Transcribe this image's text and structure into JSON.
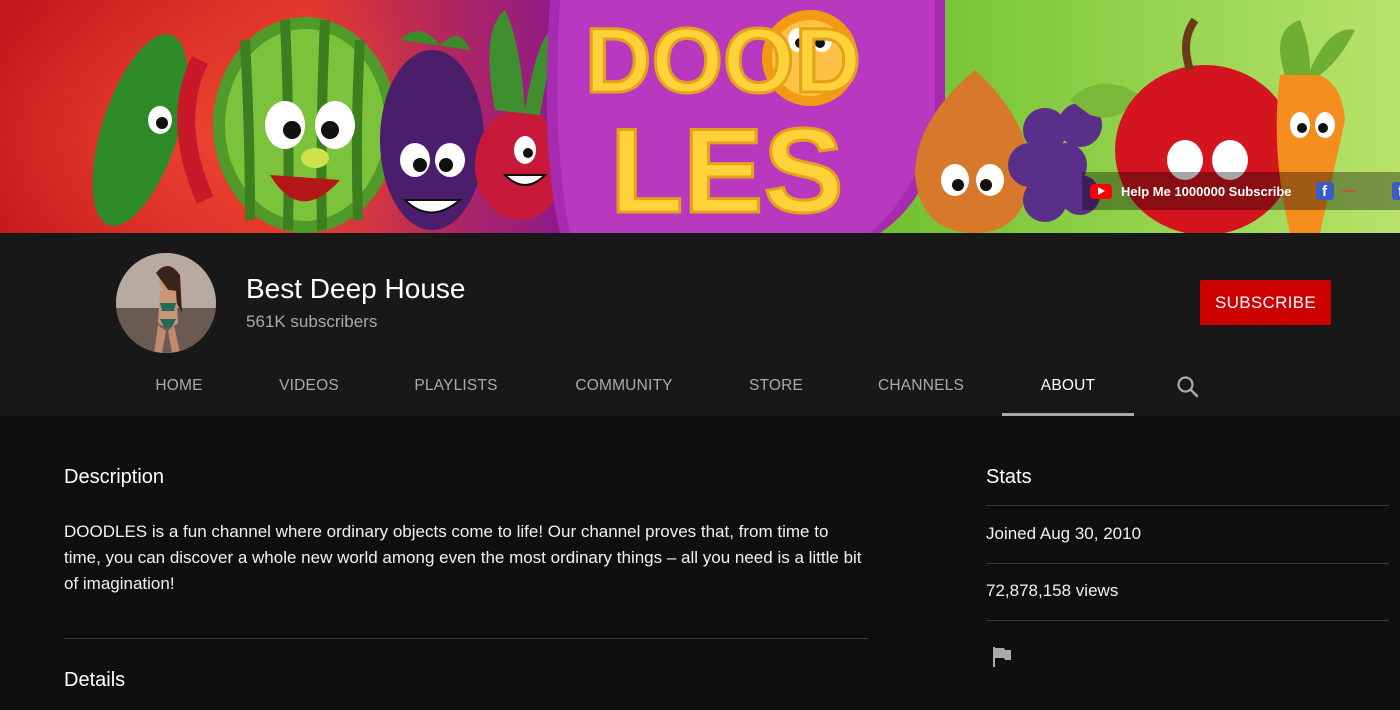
{
  "banner": {
    "logo_line1": "DOOD",
    "logo_line2": "LES",
    "links": {
      "youtube_text": "Help Me 1000000 Subscribe",
      "facebook_glyph": "f"
    }
  },
  "channel": {
    "name": "Best Deep House",
    "subscribers": "561K subscribers",
    "subscribe_label": "SUBSCRIBE"
  },
  "tabs": [
    {
      "label": "HOME"
    },
    {
      "label": "VIDEOS"
    },
    {
      "label": "PLAYLISTS"
    },
    {
      "label": "COMMUNITY"
    },
    {
      "label": "STORE"
    },
    {
      "label": "CHANNELS"
    },
    {
      "label": "ABOUT"
    }
  ],
  "about": {
    "description_title": "Description",
    "description_text": "DOODLES is a fun channel where ordinary objects come to life! Our channel proves that, from time to time, you can discover a whole new world among even the most ordinary things – all you need is a little bit of imagination!",
    "details_title": "Details",
    "stats_title": "Stats",
    "joined": "Joined Aug 30, 2010",
    "views": "72,878,158 views"
  },
  "colors": {
    "background": "#0f0f0f",
    "header": "#181818",
    "subscribe": "#cc0000",
    "secondary_text": "#aaaaaa"
  },
  "icons": {
    "search": "search-icon",
    "flag": "flag-icon",
    "youtube": "youtube-icon",
    "facebook": "facebook-icon"
  }
}
